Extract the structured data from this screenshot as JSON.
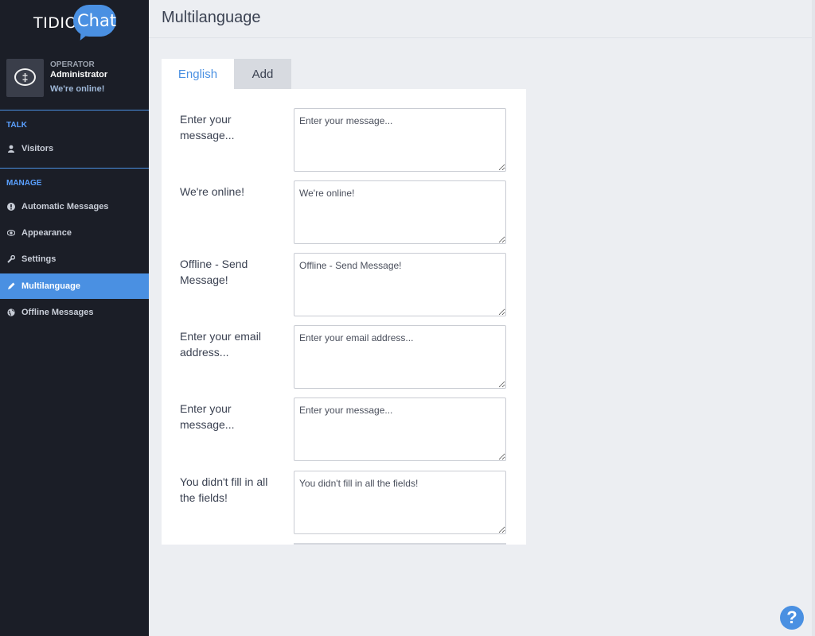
{
  "brand": {
    "name_left": "TIDIO",
    "name_right": "Chat",
    "accent": "#4a90e2"
  },
  "operator": {
    "role": "OPERATOR",
    "name": "Administrator",
    "status": "We're online!"
  },
  "sidebar": {
    "talk": {
      "title": "TALK",
      "items": [
        {
          "label": "Visitors",
          "icon": "user-icon"
        }
      ]
    },
    "manage": {
      "title": "MANAGE",
      "items": [
        {
          "label": "Automatic Messages",
          "icon": "info-icon"
        },
        {
          "label": "Appearance",
          "icon": "eye-icon"
        },
        {
          "label": "Settings",
          "icon": "wrench-icon"
        },
        {
          "label": "Multilanguage",
          "icon": "pencil-icon",
          "active": true
        },
        {
          "label": "Offline Messages",
          "icon": "globe-icon"
        }
      ]
    }
  },
  "main": {
    "title": "Multilanguage",
    "tabs": [
      {
        "label": "English",
        "active": true
      },
      {
        "label": "Add"
      }
    ],
    "rows": [
      {
        "label": "Enter your message...",
        "value": "Enter your message..."
      },
      {
        "label": "We're online!",
        "value": "We're online!"
      },
      {
        "label": "Offline - Send Message!",
        "value": "Offline - Send Message!"
      },
      {
        "label": "Enter your email address...",
        "value": "Enter your email address..."
      },
      {
        "label": "Enter your message...",
        "value": "Enter your message..."
      },
      {
        "label": "You didn't fill in all the fields!",
        "value": "You didn't fill in all the fields!"
      }
    ]
  },
  "help": {
    "label": "?",
    "icon": "help-icon"
  }
}
